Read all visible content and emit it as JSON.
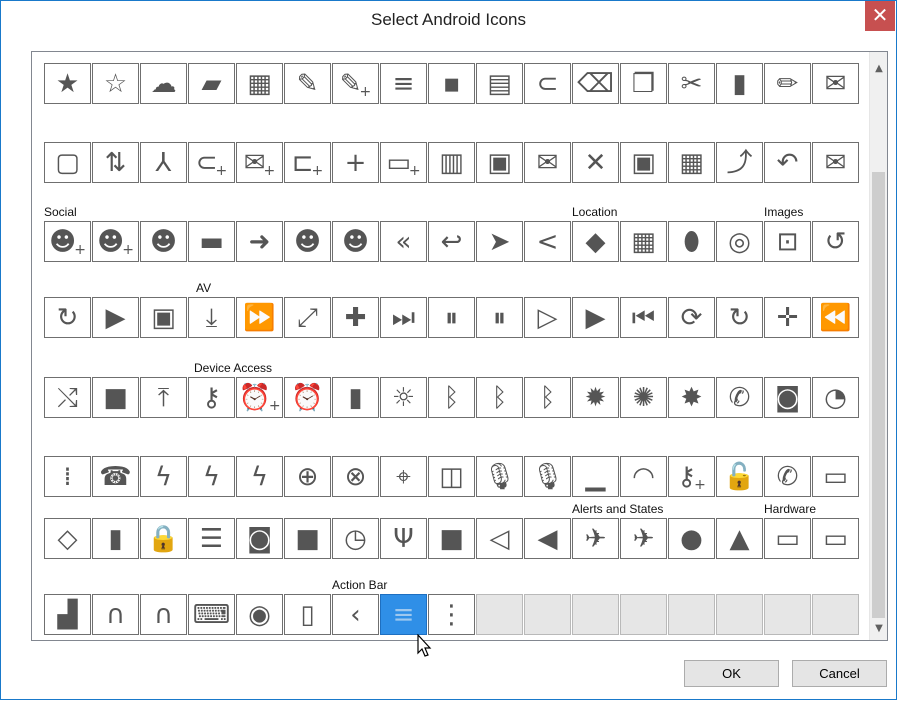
{
  "window": {
    "title": "Select Android Icons",
    "close_glyph": "✕"
  },
  "scrollbar": {
    "up": "▲",
    "down": "▼"
  },
  "labels": [
    {
      "name": "Social",
      "row": 2,
      "col": 0
    },
    {
      "name": "Location",
      "row": 2,
      "col": 11
    },
    {
      "name": "Images",
      "row": 2,
      "col": 15
    },
    {
      "name": "AV",
      "row": 3,
      "col": 2
    },
    {
      "name": "Device Access",
      "row": 4,
      "col": 3
    },
    {
      "name": "Alerts and States",
      "row": 6,
      "col": 11
    },
    {
      "name": "Hardware",
      "row": 6,
      "col": 15
    },
    {
      "name": "Action Bar",
      "row": 7,
      "col": 6
    }
  ],
  "rows": [
    [
      {
        "icon": "star-icon",
        "g": "★"
      },
      {
        "icon": "star-outline-icon",
        "g": "☆"
      },
      {
        "icon": "cloud-icon",
        "g": "☁"
      },
      {
        "icon": "folder-icon",
        "g": "▰"
      },
      {
        "icon": "calendar-icon",
        "g": "▦"
      },
      {
        "icon": "edit-icon",
        "g": "✎"
      },
      {
        "icon": "edit-add-icon",
        "g": "✎",
        "s": "+"
      },
      {
        "icon": "sort-icon",
        "g": "≡"
      },
      {
        "icon": "grid-icon",
        "g": "▪"
      },
      {
        "icon": "document-icon",
        "g": "▤"
      },
      {
        "icon": "attachment-icon",
        "g": "⊂"
      },
      {
        "icon": "backspace-icon",
        "g": "⌫"
      },
      {
        "icon": "copy-icon",
        "g": "❐"
      },
      {
        "icon": "cut-icon",
        "g": "✂"
      },
      {
        "icon": "discard-icon",
        "g": "▮"
      },
      {
        "icon": "pencil-icon",
        "g": "✏"
      },
      {
        "icon": "email-icon",
        "g": "✉"
      }
    ],
    [
      {
        "icon": "new-event-icon",
        "g": "▢"
      },
      {
        "icon": "sort-by-size-icon",
        "g": "⇅"
      },
      {
        "icon": "merge-icon",
        "g": "⅄"
      },
      {
        "icon": "new-attachment-icon",
        "g": "⊂",
        "s": "+"
      },
      {
        "icon": "new-email-icon",
        "g": "✉",
        "s": "+"
      },
      {
        "icon": "new-label-icon",
        "g": "⊏",
        "s": "+"
      },
      {
        "icon": "new-icon",
        "g": "+"
      },
      {
        "icon": "new-picture-icon",
        "g": "▭",
        "s": "+"
      },
      {
        "icon": "paste-icon",
        "g": "▥"
      },
      {
        "icon": "picture-icon",
        "g": "▣"
      },
      {
        "icon": "read-icon",
        "g": "✉"
      },
      {
        "icon": "remove-icon",
        "g": "✕"
      },
      {
        "icon": "save-icon",
        "g": "▣"
      },
      {
        "icon": "select-all-icon",
        "g": "▦"
      },
      {
        "icon": "split-icon",
        "g": "⤴"
      },
      {
        "icon": "undo-icon",
        "g": "↶"
      },
      {
        "icon": "unread-icon",
        "g": "✉"
      }
    ],
    [
      {
        "icon": "add-group-icon",
        "g": "☻",
        "s": "+"
      },
      {
        "icon": "add-person-icon",
        "g": "☻",
        "s": "+"
      },
      {
        "icon": "group-icon",
        "g": "☻"
      },
      {
        "icon": "chat-icon",
        "g": "▬"
      },
      {
        "icon": "forward-icon",
        "g": "➜"
      },
      {
        "icon": "cc-bcc-icon",
        "g": "☻"
      },
      {
        "icon": "person-icon",
        "g": "☻"
      },
      {
        "icon": "reply-all-icon",
        "g": "«"
      },
      {
        "icon": "reply-icon",
        "g": "↩"
      },
      {
        "icon": "send-now-icon",
        "g": "➤"
      },
      {
        "icon": "share-icon",
        "g": "<"
      },
      {
        "icon": "directions-icon",
        "g": "◆"
      },
      {
        "icon": "map-icon",
        "g": "▦"
      },
      {
        "icon": "place-icon",
        "g": "⬮"
      },
      {
        "icon": "web-site-icon",
        "g": "◎"
      },
      {
        "icon": "crop-icon",
        "g": "⊡"
      },
      {
        "icon": "rotate-left-icon",
        "g": "↺"
      }
    ],
    [
      {
        "icon": "rotate-right-icon",
        "g": "↻"
      },
      {
        "icon": "slideshow-icon",
        "g": "▶"
      },
      {
        "icon": "add-to-queue-icon",
        "g": "▣"
      },
      {
        "icon": "download-icon",
        "g": "⤓"
      },
      {
        "icon": "fast-forward-icon",
        "g": "⏩"
      },
      {
        "icon": "full-screen-icon",
        "g": "⤢"
      },
      {
        "icon": "make-available-offline-icon",
        "g": "✚"
      },
      {
        "icon": "next-icon",
        "g": "⏭"
      },
      {
        "icon": "pause-over-video-icon",
        "g": "⏸"
      },
      {
        "icon": "pause-icon",
        "g": "⏸"
      },
      {
        "icon": "play-over-video-icon",
        "g": "▷"
      },
      {
        "icon": "play-icon",
        "g": "▶"
      },
      {
        "icon": "previous-icon",
        "g": "⏮"
      },
      {
        "icon": "repeat-icon",
        "g": "⟳"
      },
      {
        "icon": "replay-icon",
        "g": "↻"
      },
      {
        "icon": "return-from-full-screen-icon",
        "g": "✛"
      },
      {
        "icon": "rewind-icon",
        "g": "⏪"
      }
    ],
    [
      {
        "icon": "shuffle-icon",
        "g": "⤭"
      },
      {
        "icon": "stop-icon",
        "g": "■"
      },
      {
        "icon": "upload-icon",
        "g": "⤒"
      },
      {
        "icon": "accounts-icon",
        "g": "⚷"
      },
      {
        "icon": "add-alarm-icon",
        "g": "⏰",
        "s": "+"
      },
      {
        "icon": "alarms-icon",
        "g": "⏰"
      },
      {
        "icon": "battery-icon",
        "g": "▮"
      },
      {
        "icon": "bightness-low-icon",
        "g": "☼"
      },
      {
        "icon": "bluetooth-connected-icon",
        "g": "ᛒ"
      },
      {
        "icon": "bluetooth-icon",
        "g": "ᛒ"
      },
      {
        "icon": "bluetooth-searching-icon",
        "g": "ᛒ"
      },
      {
        "icon": "brightness-auto-icon",
        "g": "✹"
      },
      {
        "icon": "brightness-high-icon",
        "g": "✺"
      },
      {
        "icon": "brightness-medium-icon",
        "g": "✸"
      },
      {
        "icon": "call-icon",
        "g": "✆"
      },
      {
        "icon": "camera-icon",
        "g": "◙"
      },
      {
        "icon": "data-usage-icon",
        "g": "◔"
      }
    ],
    [
      {
        "icon": "dial-pad-icon",
        "g": "⁞"
      },
      {
        "icon": "end-call-icon",
        "g": "☎"
      },
      {
        "icon": "flash-automatic-icon",
        "g": "ϟ"
      },
      {
        "icon": "flash-off-icon",
        "g": "ϟ"
      },
      {
        "icon": "flash-on-icon",
        "g": "ϟ"
      },
      {
        "icon": "location-found-icon",
        "g": "⊕"
      },
      {
        "icon": "location-off-icon",
        "g": "⊗"
      },
      {
        "icon": "location-searching-icon",
        "g": "⌖"
      },
      {
        "icon": "lock-rotation-icon",
        "g": "◫"
      },
      {
        "icon": "mic-muted-icon",
        "g": "🎙"
      },
      {
        "icon": "mic-icon",
        "g": "🎙"
      },
      {
        "icon": "network-cell-icon",
        "g": "▁"
      },
      {
        "icon": "network-wifi-icon",
        "g": "◠"
      },
      {
        "icon": "new-account-icon",
        "g": "⚷",
        "s": "+"
      },
      {
        "icon": "not-secure-icon",
        "g": "🔓"
      },
      {
        "icon": "ring-volume-icon",
        "g": "✆"
      },
      {
        "icon": "screen-locked-to-landscape-icon",
        "g": "▭"
      }
    ],
    [
      {
        "icon": "screen-rotation-icon",
        "g": "◇"
      },
      {
        "icon": "sd-storage-icon",
        "g": "▮"
      },
      {
        "icon": "secure-icon",
        "g": "🔒"
      },
      {
        "icon": "storage-icon",
        "g": "☰"
      },
      {
        "icon": "switch-camera-icon",
        "g": "◙"
      },
      {
        "icon": "switch-video-icon",
        "g": "■"
      },
      {
        "icon": "time-icon",
        "g": "◷"
      },
      {
        "icon": "usb-icon",
        "g": "Ψ"
      },
      {
        "icon": "video-icon",
        "g": "■"
      },
      {
        "icon": "volume-muted-icon",
        "g": "◁"
      },
      {
        "icon": "volume-on-icon",
        "g": "◀"
      },
      {
        "icon": "airplane-mode-off-icon",
        "g": "✈"
      },
      {
        "icon": "airplane-mode-on-icon",
        "g": "✈"
      },
      {
        "icon": "error-icon",
        "g": "●"
      },
      {
        "icon": "warning-icon",
        "g": "▲"
      },
      {
        "icon": "computer-icon",
        "g": "▭"
      },
      {
        "icon": "desktop-icon",
        "g": "▭"
      }
    ],
    [
      {
        "icon": "dock-icon",
        "g": "▟"
      },
      {
        "icon": "headphones-icon",
        "g": "∩"
      },
      {
        "icon": "headset-icon",
        "g": "∩"
      },
      {
        "icon": "keyboard-icon",
        "g": "⌨"
      },
      {
        "icon": "mouse-icon",
        "g": "◉"
      },
      {
        "icon": "phone-icon",
        "g": "▯"
      },
      {
        "icon": "back-icon",
        "g": "‹"
      },
      {
        "icon": "overflow-icon",
        "g": "≡",
        "selected": true
      },
      {
        "icon": "overflow-vertical-icon",
        "g": "⋮"
      },
      {
        "empty": true
      },
      {
        "empty": true
      },
      {
        "empty": true
      },
      {
        "empty": true
      },
      {
        "empty": true
      },
      {
        "empty": true
      },
      {
        "empty": true
      },
      {
        "empty": true
      }
    ]
  ],
  "buttons": {
    "ok": "OK",
    "cancel": "Cancel"
  }
}
